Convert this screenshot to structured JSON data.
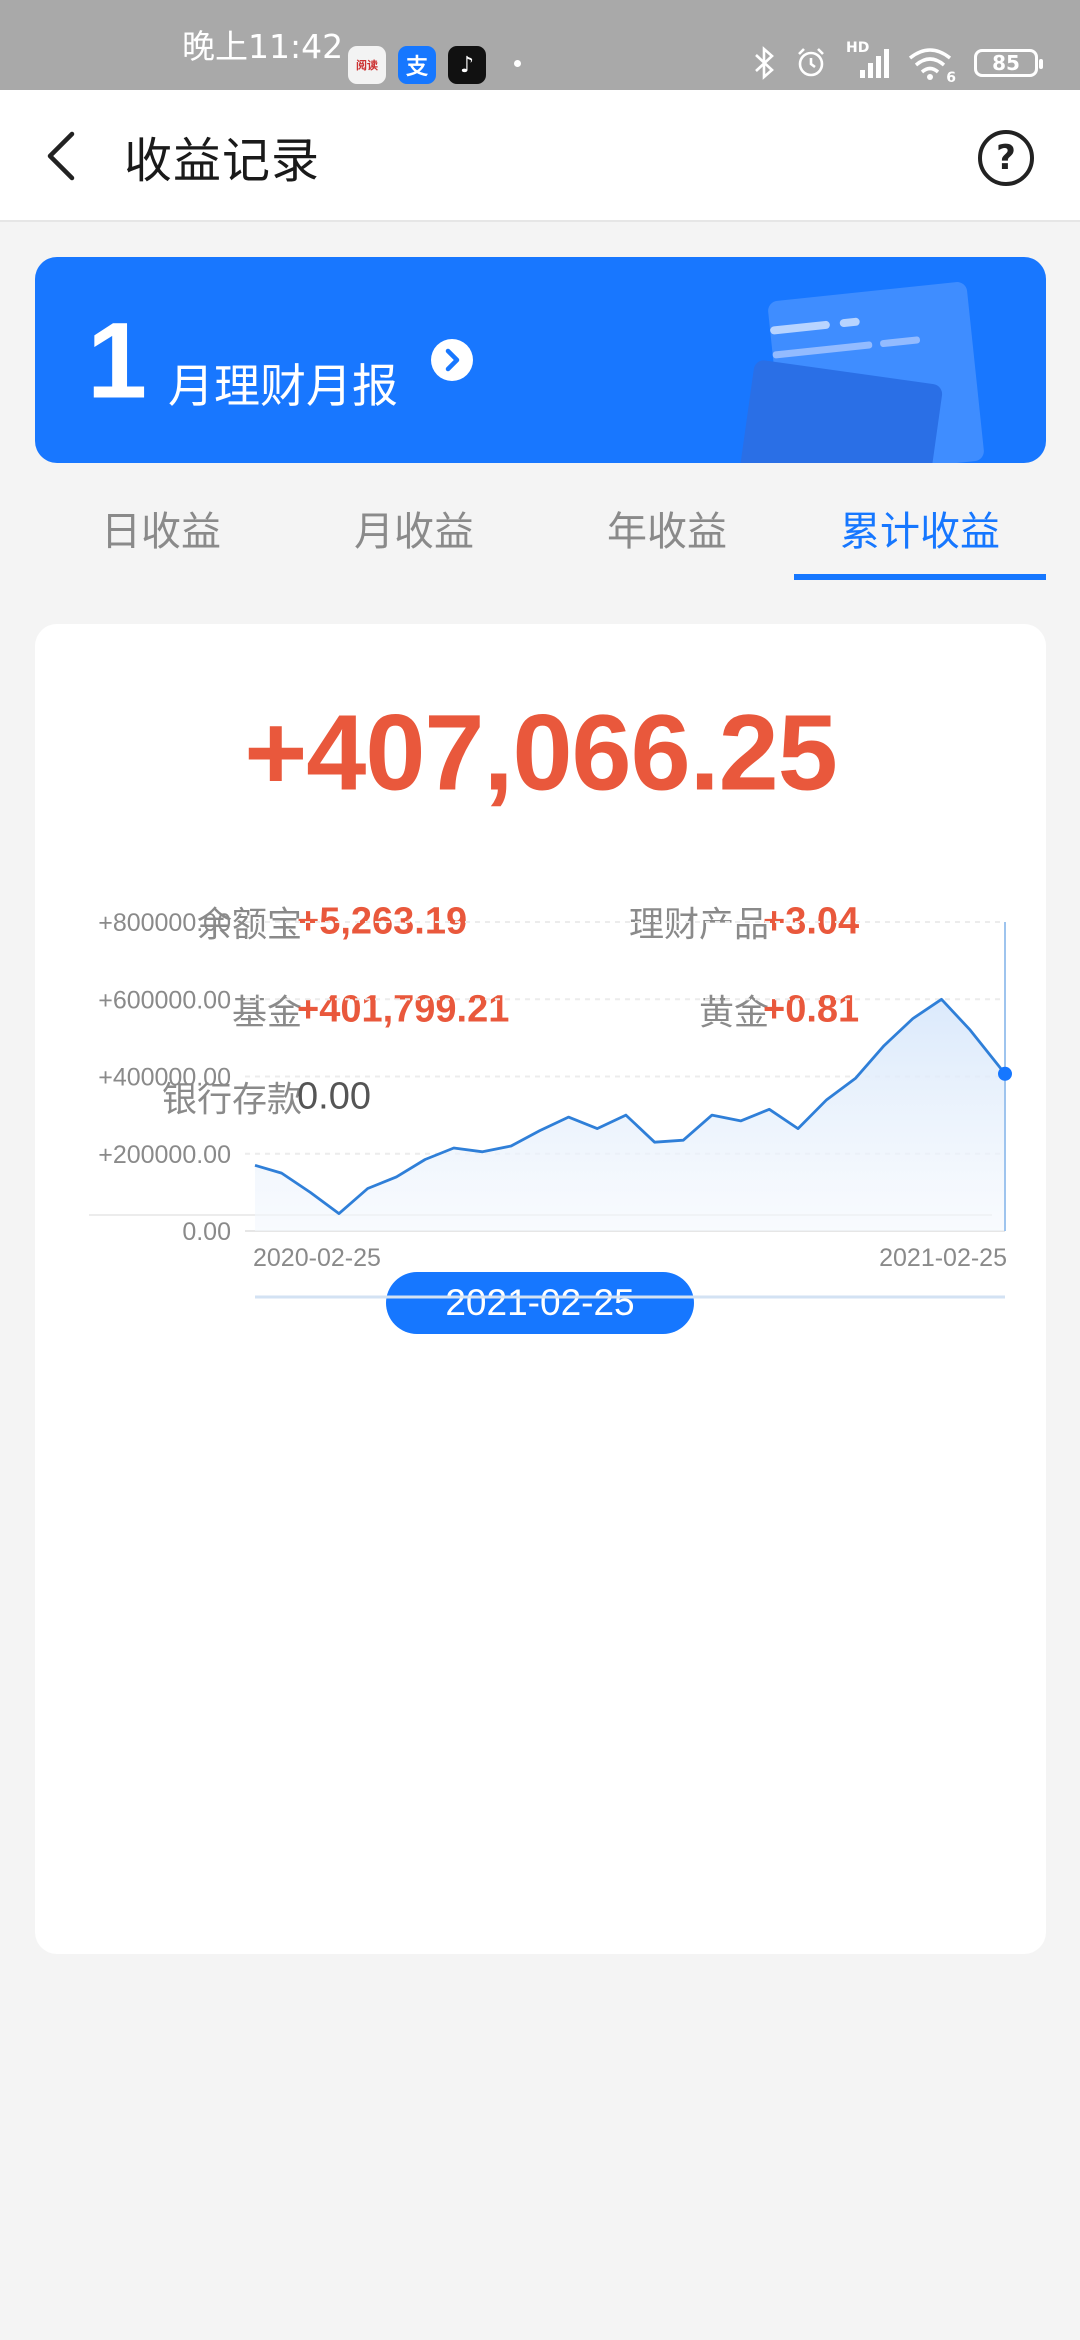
{
  "status_bar": {
    "time": "晚上11:42",
    "battery": "85",
    "signal_label": "HD",
    "wifi_sub": "6",
    "app_icons": [
      {
        "name": "news-app-icon",
        "color": "#ffffff",
        "text": "阅读"
      },
      {
        "name": "alipay-icon",
        "color": "#1677ff",
        "text": "支"
      },
      {
        "name": "tiktok-icon",
        "color": "#111111",
        "text": "♪"
      }
    ]
  },
  "header": {
    "title": "收益记录",
    "back_icon": "chevron-left-icon",
    "help_icon": "question-circle-icon",
    "help_glyph": "?"
  },
  "banner": {
    "number": "1",
    "text": "月理财月报",
    "arrow_icon": "chevron-right-circle-icon"
  },
  "tabs": [
    {
      "label": "日收益",
      "active": false
    },
    {
      "label": "月收益",
      "active": false
    },
    {
      "label": "年收益",
      "active": false
    },
    {
      "label": "累计收益",
      "active": true
    }
  ],
  "summary": {
    "total": "+407,066.25",
    "items": [
      {
        "label": "余额宝",
        "value": "+5,263.19"
      },
      {
        "label": "理财产品",
        "value": "+3.04"
      },
      {
        "label": "基金",
        "value": "+401,799.21"
      },
      {
        "label": "黄金",
        "value": "+0.81"
      },
      {
        "label": "银行存款",
        "value": "0.00"
      }
    ]
  },
  "colors": {
    "accent": "#1677ff",
    "positive": "#e9583c",
    "line": "#2f7fd8"
  },
  "chart_data": {
    "type": "area",
    "selected_date": "2021-02-25",
    "x_labels": [
      "2020-02-25",
      "2021-02-25"
    ],
    "y_ticks": [
      "+800000.00",
      "+600000.00",
      "+400000.00",
      "+200000.00",
      "0.00"
    ],
    "ylim": [
      0,
      800000
    ],
    "grid": true,
    "x": [
      "2020-02-25",
      "2020-03-09",
      "2020-03-23",
      "2020-04-06",
      "2020-04-20",
      "2020-05-04",
      "2020-05-18",
      "2020-06-01",
      "2020-06-15",
      "2020-06-29",
      "2020-07-13",
      "2020-07-27",
      "2020-08-10",
      "2020-08-24",
      "2020-09-07",
      "2020-09-21",
      "2020-10-05",
      "2020-10-19",
      "2020-11-02",
      "2020-11-16",
      "2020-11-30",
      "2020-12-14",
      "2020-12-28",
      "2021-01-11",
      "2021-01-25",
      "2021-02-08",
      "2021-02-25"
    ],
    "values": [
      170000,
      150000,
      100000,
      45000,
      110000,
      140000,
      185000,
      215000,
      205000,
      220000,
      260000,
      295000,
      265000,
      300000,
      230000,
      235000,
      300000,
      285000,
      315000,
      265000,
      340000,
      395000,
      480000,
      550000,
      600000,
      520000,
      407066
    ]
  }
}
